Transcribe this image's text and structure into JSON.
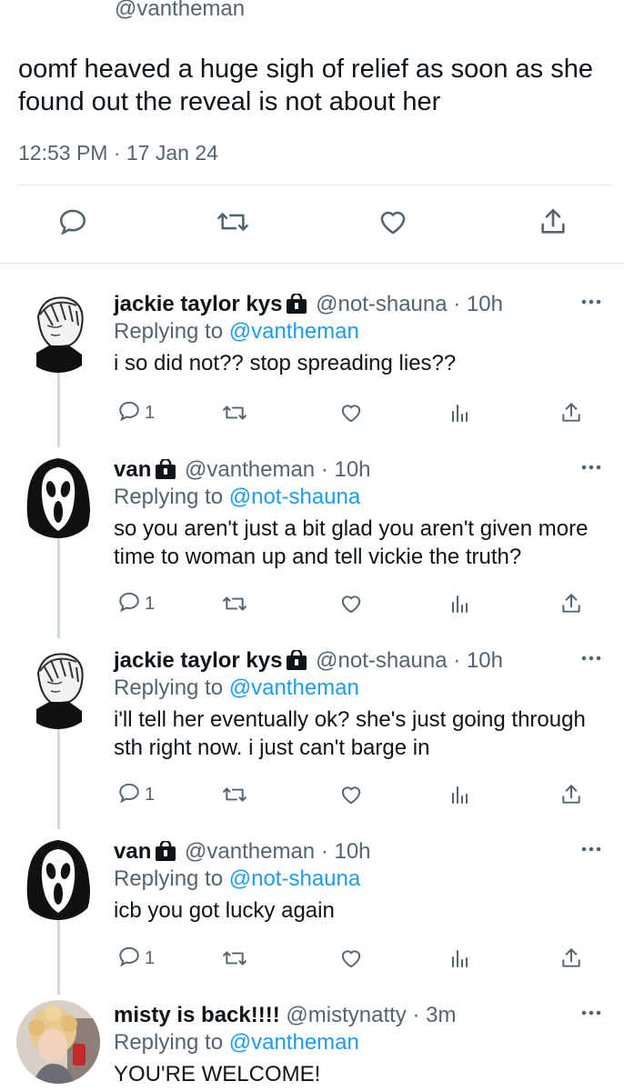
{
  "main_tweet": {
    "handle": "@vantheman",
    "text": "oomf heaved a huge sigh of relief as soon as she found out the reveal is not about her",
    "timestamp": "12:53 PM · 17 Jan 24",
    "actions": [
      "reply-icon",
      "retweet-icon",
      "like-icon",
      "share-icon"
    ]
  },
  "replies": [
    {
      "name": "jackie taylor kys",
      "handle": "@not-shauna",
      "time": "· 10h",
      "replying_label": "Replying to",
      "replying_to": "@vantheman",
      "text": "i so did not?? stop spreading lies??",
      "reply_count": "1",
      "avatar": "sketch-avatar"
    },
    {
      "name": "van",
      "handle": "@vantheman",
      "time": "· 10h",
      "replying_label": "Replying to",
      "replying_to": "@not-shauna",
      "text": "so you aren't just a bit glad you aren't given more time to woman up and tell vickie the truth?",
      "reply_count": "1",
      "avatar": "ghostface-avatar"
    },
    {
      "name": "jackie taylor kys",
      "handle": "@not-shauna",
      "time": "· 10h",
      "replying_label": "Replying to",
      "replying_to": "@vantheman",
      "text": "i'll tell her eventually ok? she's just going through sth right now. i just can't barge in",
      "reply_count": "1",
      "avatar": "sketch-avatar"
    },
    {
      "name": "van",
      "handle": "@vantheman",
      "time": "· 10h",
      "replying_label": "Replying to",
      "replying_to": "@not-shauna",
      "text": "icb you got lucky again",
      "reply_count": "1",
      "avatar": "ghostface-avatar"
    },
    {
      "name": "misty is back!!!!",
      "handle": "@mistynatty",
      "time": "· 3m",
      "replying_label": "Replying to",
      "replying_to": "@vantheman",
      "text": "YOU'RE WELCOME!",
      "avatar": "photo-avatar"
    }
  ],
  "colors": {
    "text": "#0f1419",
    "secondary": "#536471",
    "link": "#1d9bf0",
    "divider": "#dde3e8",
    "thread_line": "#cfd9de"
  }
}
